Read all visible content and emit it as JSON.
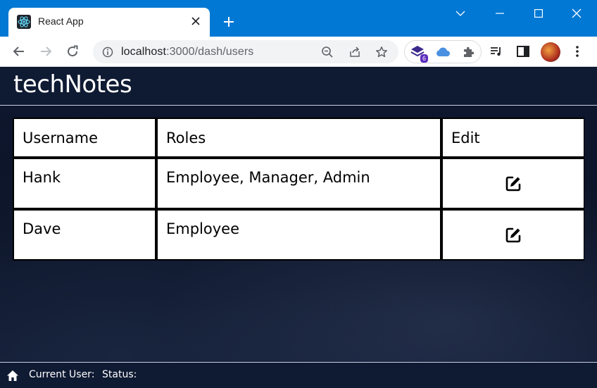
{
  "browser": {
    "tab_title": "React App",
    "url_host": "localhost",
    "url_rest": ":3000/dash/users"
  },
  "toolbar": {
    "extension_badge": "6"
  },
  "app": {
    "title": "techNotes"
  },
  "table": {
    "headers": [
      "Username",
      "Roles",
      "Edit"
    ],
    "rows": [
      {
        "username": "Hank",
        "roles": "Employee, Manager, Admin"
      },
      {
        "username": "Dave",
        "roles": "Employee"
      }
    ]
  },
  "footer": {
    "current_user_label": "Current User:",
    "status_label": "Status:"
  },
  "colors": {
    "titlebar": "#0078d4",
    "app_bg": "#0f1a33",
    "table_bg": "#ffffff"
  }
}
